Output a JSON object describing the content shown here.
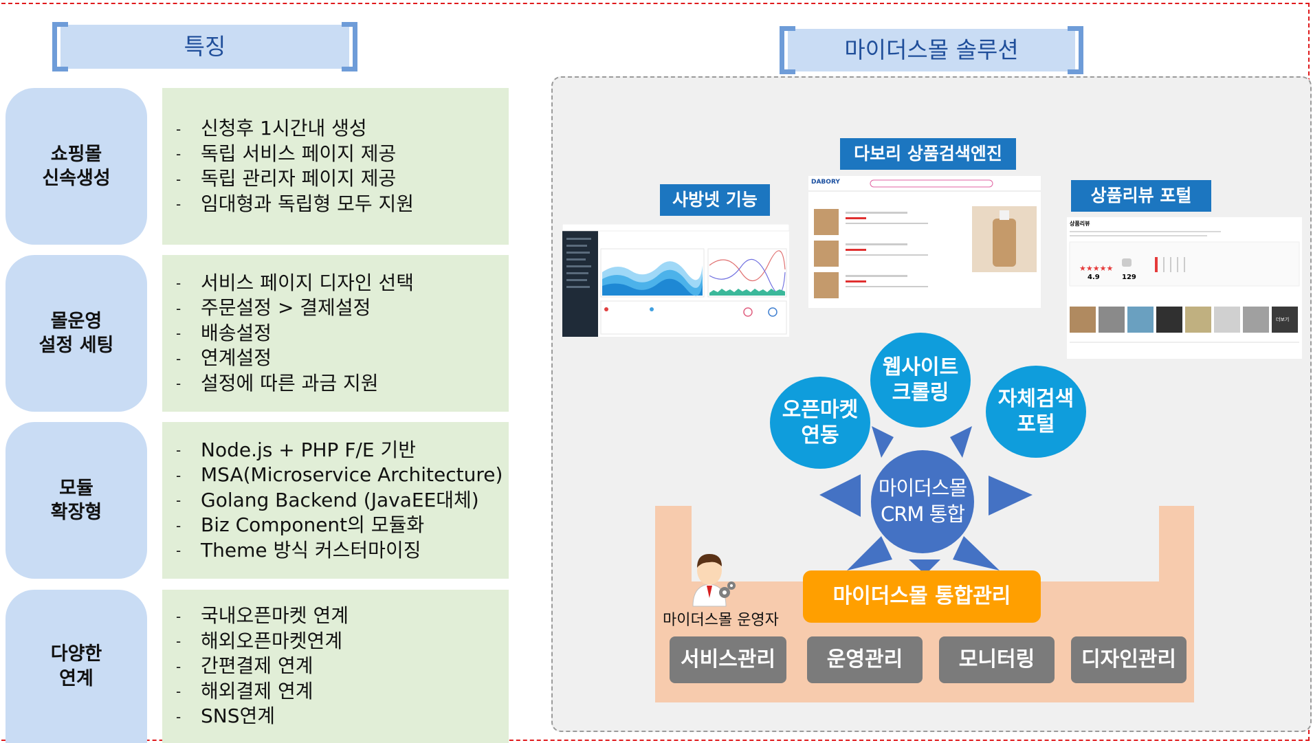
{
  "left_header": "특징",
  "right_header": "마이더스몰 솔루션",
  "rows": [
    {
      "category": "쇼핑몰\n신속생성",
      "items": [
        "신청후 1시간내 생성",
        "독립 서비스 페이지 제공",
        "독립 관리자 페이지 제공",
        "임대형과 독립형 모두 지원"
      ]
    },
    {
      "category": "몰운영\n설정 세팅",
      "items": [
        "서비스 페이지 디자인 선택",
        "주문설정 > 결제설정",
        "배송설정",
        "연계설정",
        "설정에 따른 과금 지원"
      ]
    },
    {
      "category": "모듈\n확장형",
      "items": [
        "Node.js + PHP F/E 기반",
        "MSA(Microservice Architecture)",
        "Golang Backend (JavaEE대체)",
        "Biz Component의 모듈화",
        "Theme 방식 커스터마이징"
      ]
    },
    {
      "category": "다양한\n연계",
      "items": [
        "국내오픈마켓 연계",
        "해외오픈마켓연계",
        "간편결제 연계",
        "해외결제 연계",
        "SNS연계"
      ]
    }
  ],
  "bullet": "-",
  "solution": {
    "tags": {
      "sabangnet": "사방넷 기능",
      "dabori": "다보리 상품검색엔진",
      "review": "상품리뷰 포털"
    },
    "screens": {
      "dabori_logo": "DABORY",
      "review_title": "상품리뷰",
      "review_rating": "4.9",
      "review_count": "129",
      "review_stars": "★★★★★",
      "review_more": "더보기"
    },
    "hub": {
      "center": "마이더스몰\nCRM 통합",
      "circles": [
        "오픈마켓\n연동",
        "웹사이트\n크롤링",
        "자체검색\n포털"
      ]
    },
    "operator_label": "마이더스몰 운영자",
    "integrated_management": "마이더스몰 통합관리",
    "modules": [
      "서비스관리",
      "운영관리",
      "모니터링",
      "디자인관리"
    ]
  }
}
